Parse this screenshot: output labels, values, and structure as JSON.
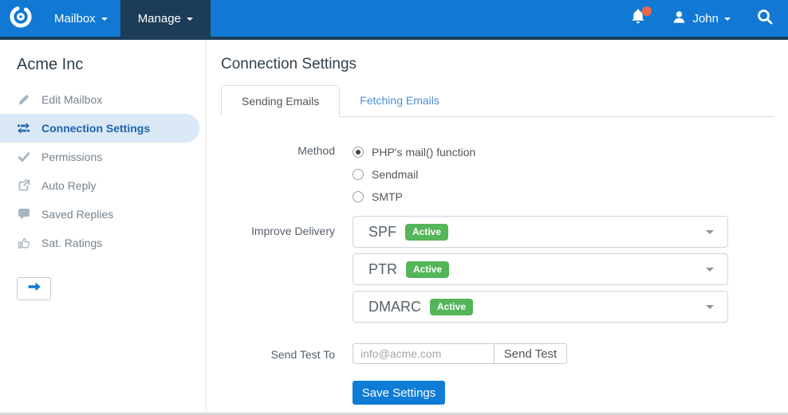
{
  "topbar": {
    "mailbox_label": "Mailbox",
    "manage_label": "Manage",
    "user_name": "John",
    "icons": [
      "logo-icon",
      "bell-icon",
      "notification-dot",
      "user-icon",
      "search-icon",
      "caret-down-icon"
    ]
  },
  "sidebar": {
    "title": "Acme Inc",
    "items": [
      {
        "label": "Edit Mailbox",
        "icon": "pencil-icon",
        "active": false
      },
      {
        "label": "Connection Settings",
        "icon": "transfer-icon",
        "active": true
      },
      {
        "label": "Permissions",
        "icon": "check-icon",
        "active": false
      },
      {
        "label": "Auto Reply",
        "icon": "share-icon",
        "active": false
      },
      {
        "label": "Saved Replies",
        "icon": "comment-icon",
        "active": false
      },
      {
        "label": "Sat. Ratings",
        "icon": "thumbs-up-icon",
        "active": false
      }
    ],
    "toggle_icon": "arrow-right-icon"
  },
  "main": {
    "title": "Connection Settings",
    "tabs": [
      {
        "label": "Sending Emails",
        "active": true
      },
      {
        "label": "Fetching Emails",
        "active": false
      }
    ],
    "form": {
      "method": {
        "label": "Method",
        "options": [
          "PHP's mail() function",
          "Sendmail",
          "SMTP"
        ],
        "selected": "PHP's mail() function"
      },
      "improve_delivery": {
        "label": "Improve Delivery",
        "entries": [
          {
            "name": "SPF",
            "badge": "Active"
          },
          {
            "name": "PTR",
            "badge": "Active"
          },
          {
            "name": "DMARC",
            "badge": "Active"
          }
        ]
      },
      "send_test": {
        "label": "Send Test To",
        "placeholder": "info@acme.com",
        "value": "",
        "button_label": "Send Test"
      },
      "save_button_label": "Save Settings"
    }
  },
  "colors": {
    "topbar_blue": "#1179d3",
    "navbar_dark": "#1d3c57",
    "active_item_bg": "#dbe8f6",
    "active_item_text": "#1a64ae",
    "badge_green": "#55b559",
    "notification_dot": "#f06543",
    "tab_link_blue": "#4a90d9",
    "save_button_blue": "#0f7cd6"
  }
}
